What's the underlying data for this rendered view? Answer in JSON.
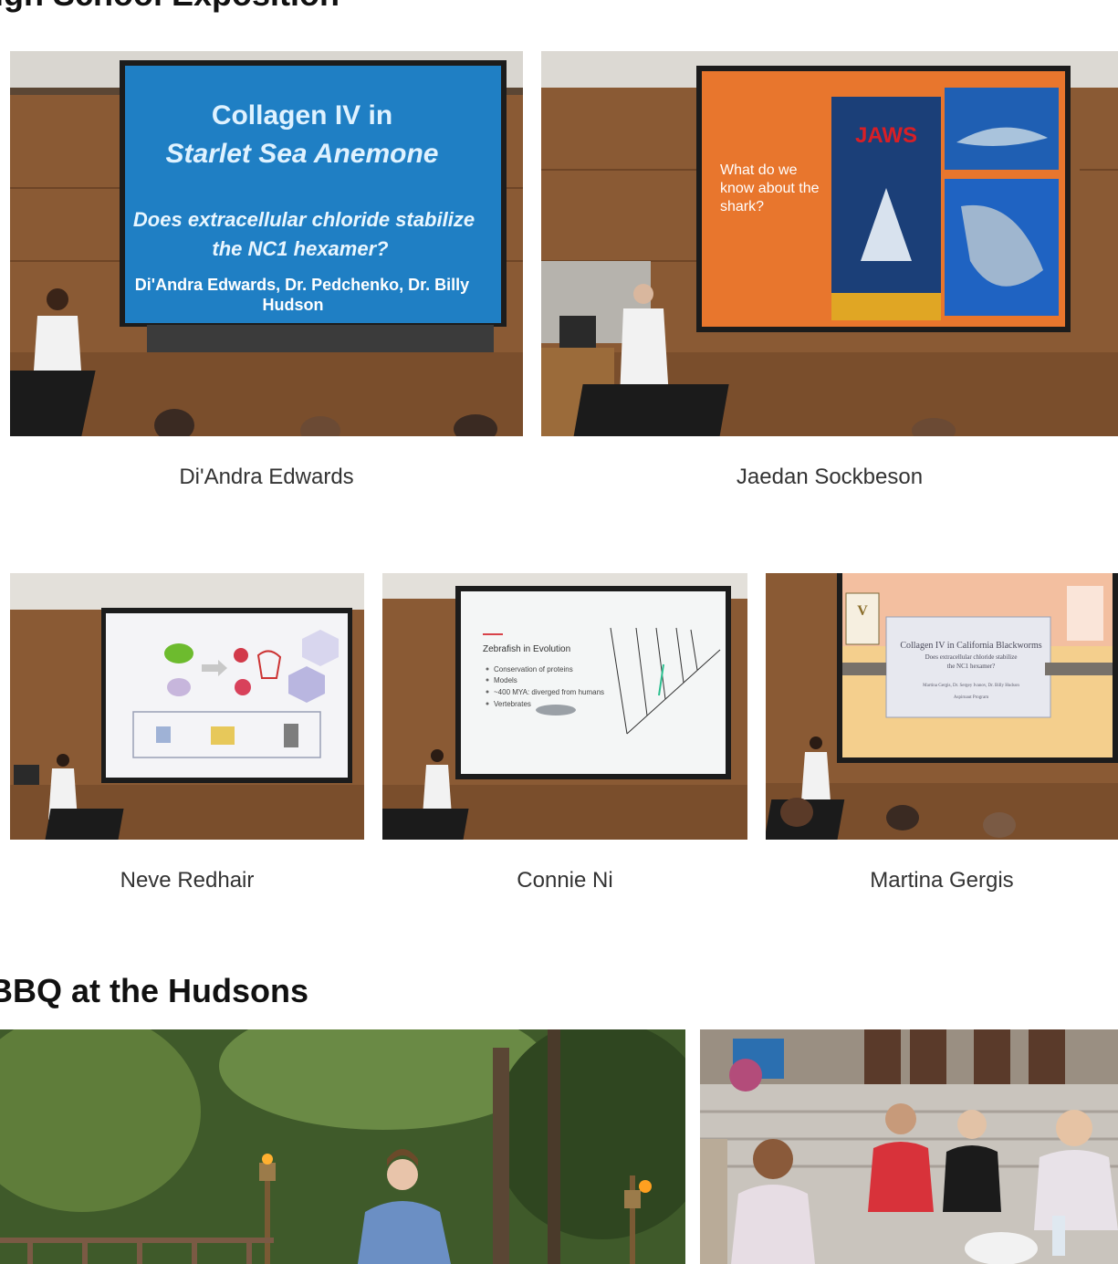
{
  "section_exposition": {
    "title": "High School Exposition",
    "photos": [
      {
        "caption": "Di'Andra Edwards",
        "slide_lines": [
          "Collagen IV in",
          "Starlet Sea Anemone",
          "Does extracellular chloride stabilize",
          "the NC1 hexamer?",
          "Di'Andra Edwards, Dr. Pedchenko, Dr. Billy",
          "Hudson"
        ]
      },
      {
        "caption": "Jaedan Sockbeson",
        "slide_lines": [
          "What do we",
          "know about the",
          "shark?",
          "JAWS"
        ]
      },
      {
        "caption": "Neve Redhair",
        "slide_lines": []
      },
      {
        "caption": "Connie Ni",
        "slide_lines": [
          "Zebrafish in Evolution",
          "Conservation of proteins",
          "Models",
          "~400 MYA: diverged from humans",
          "Vertebrates"
        ]
      },
      {
        "caption": "Martina Gergis",
        "slide_lines": [
          "Collagen IV in California Blackworms",
          "Does extracellular chloride stabilize",
          "the NC1 hexamer?",
          "Martina Gergis, Dr. Sergey Ivanov, Dr. Billy Hudson",
          "Aspirnaut Program"
        ]
      }
    ]
  },
  "section_bbq": {
    "title": "BBQ at the Hudsons"
  },
  "colors": {
    "wood": "#8a5a34",
    "blue_slide": "#1f7fc4",
    "orange_slide": "#e8762d",
    "foliage": "#3f5a2a",
    "deck": "#c9c4bd"
  }
}
